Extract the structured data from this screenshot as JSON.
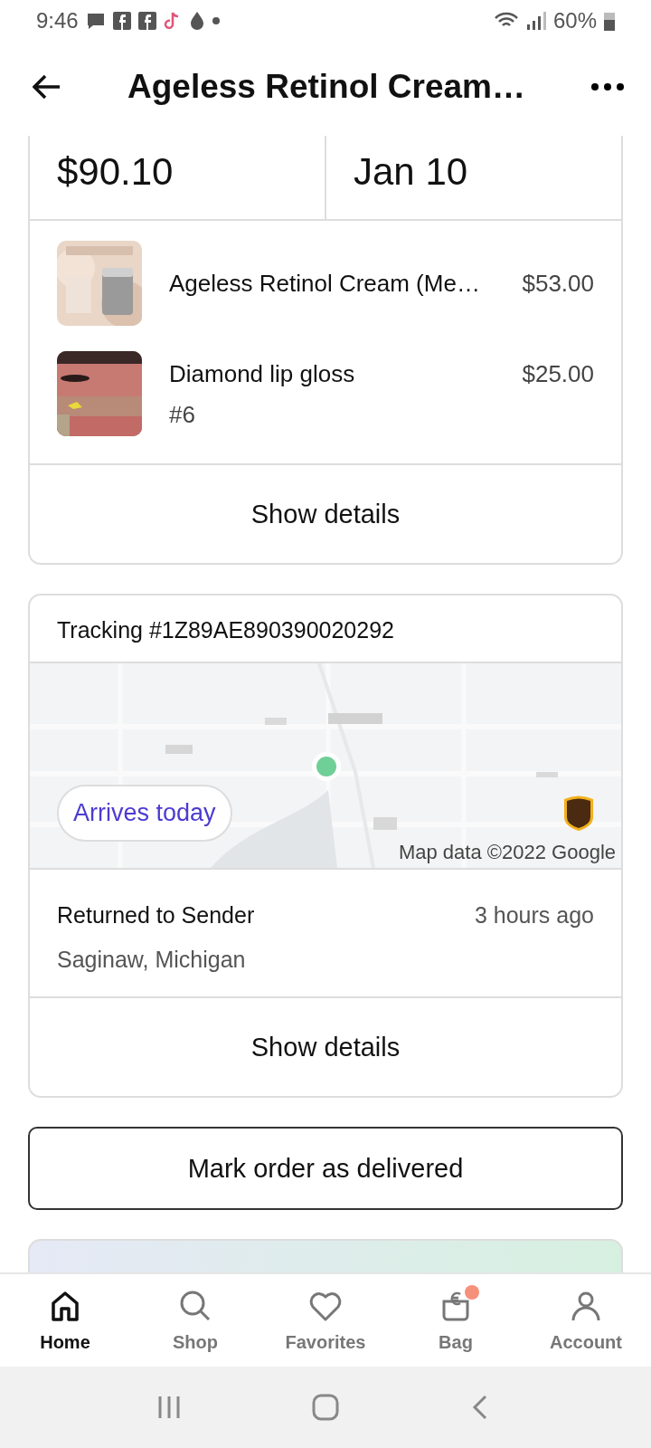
{
  "status_bar": {
    "time": "9:46",
    "battery": "60%"
  },
  "header": {
    "title": "Ageless Retinol Cream…"
  },
  "order_summary": {
    "total": "$90.10",
    "date": "Jan 10",
    "items": [
      {
        "name": "Ageless Retinol Cream (Me…",
        "price": "$53.00",
        "kind": "picture"
      },
      {
        "name": "Diamond lip gloss",
        "variant": "#6",
        "price": "$25.00",
        "kind": "picture"
      }
    ],
    "action": "Show details"
  },
  "tracking": {
    "number": "Tracking #1Z89AE890390020292",
    "eta": "Arrives today",
    "map_credit": "Map data ©2022 Google",
    "event": {
      "status": "Returned to Sender",
      "time": "3 hours ago",
      "location": "Saginaw, Michigan"
    },
    "action": "Show details"
  },
  "mark_delivered": "Mark order as delivered",
  "bottom_nav": [
    {
      "label": "Home",
      "kind": "home",
      "selected": true,
      "badge": false
    },
    {
      "label": "Shop",
      "kind": "search",
      "selected": false,
      "badge": false
    },
    {
      "label": "Favorites",
      "kind": "heart",
      "selected": false,
      "badge": false
    },
    {
      "label": "Bag",
      "kind": "bag",
      "selected": false,
      "badge": true
    },
    {
      "label": "Account",
      "kind": "person",
      "selected": false,
      "badge": false
    }
  ]
}
